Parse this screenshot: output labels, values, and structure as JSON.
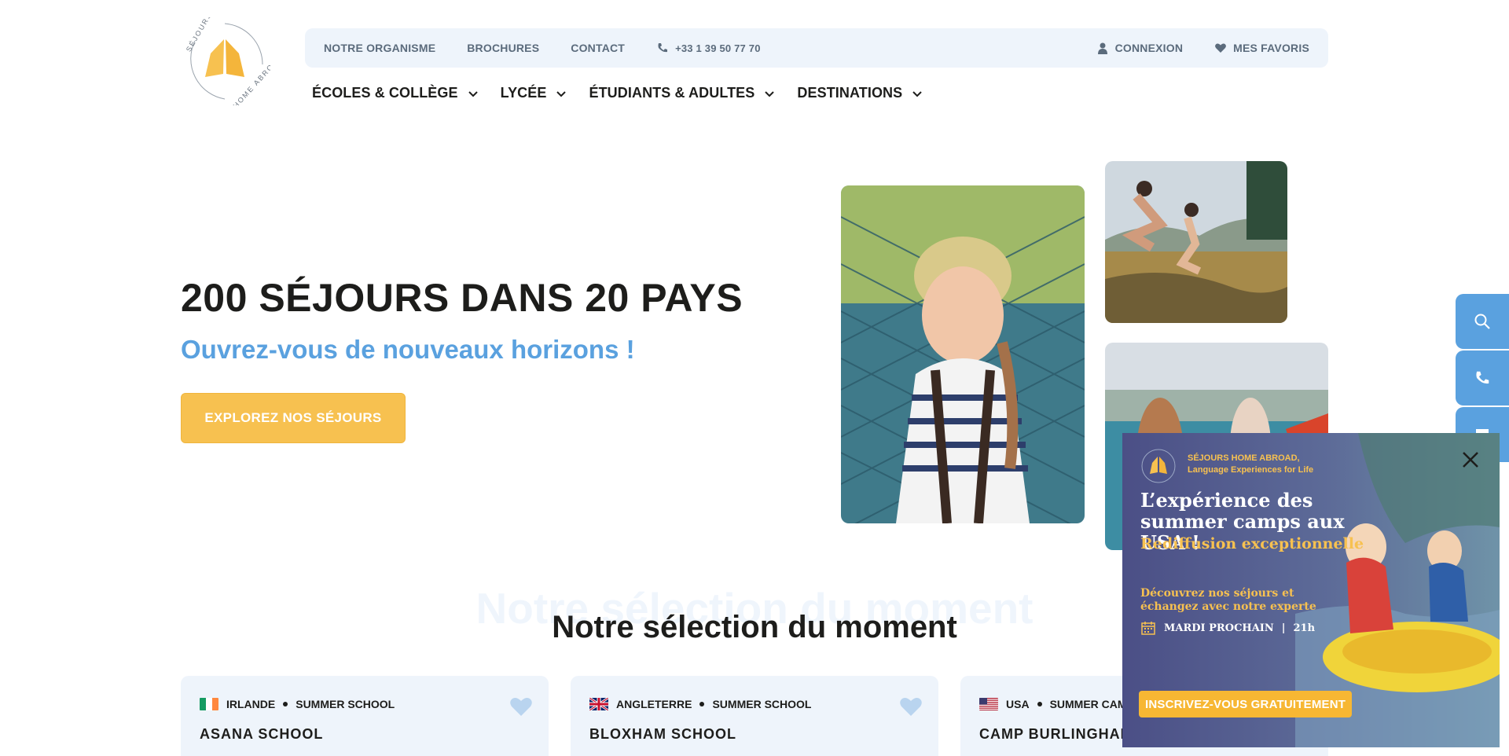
{
  "brand": {
    "logo_text_top": "SÉJOURS",
    "logo_text_bottom": "HOME ABROAD",
    "accent": "#f7c150",
    "blue": "#5aa1df",
    "dark": "#1d1d1b"
  },
  "topbar": {
    "about": "NOTRE ORGANISME",
    "brochures": "BROCHURES",
    "contact": "CONTACT",
    "phone": "+33 1 39 50 77 70",
    "login": "CONNEXION",
    "favorites": "MES FAVORIS"
  },
  "nav": {
    "items": [
      {
        "label": "ÉCOLES & COLLÈGE"
      },
      {
        "label": "LYCÉE"
      },
      {
        "label": "ÉTUDIANTS & ADULTES"
      },
      {
        "label": "DESTINATIONS"
      }
    ]
  },
  "hero": {
    "title": "200 SÉJOURS DANS 20 PAYS",
    "subtitle": "Ouvrez-vous de nouveaux horizons !",
    "cta": "EXPLOREZ NOS SÉJOURS"
  },
  "selection": {
    "ghost_title": "Notre sélection du moment",
    "title": "Notre sélection du moment",
    "cards": [
      {
        "country": "IRLANDE",
        "type": "SUMMER SCHOOL",
        "name": "ASANA SCHOOL",
        "flag": "ireland-flag"
      },
      {
        "country": "ANGLETERRE",
        "type": "SUMMER SCHOOL",
        "name": "BLOXHAM SCHOOL",
        "flag": "uk-flag"
      },
      {
        "country": "USA",
        "type": "SUMMER CAMP",
        "name": "CAMP BURLINGHAM",
        "flag": "usa-flag"
      }
    ]
  },
  "side_buttons": [
    "search-icon",
    "phone-icon",
    "chat-icon"
  ],
  "popup": {
    "brand_line1": "SÉJOURS HOME ABROAD,",
    "brand_line2": "Language Experiences for Life",
    "headline": "L’expérience des summer camps aux USA !",
    "subheadline": "Rediffusion exceptionnelle",
    "body": "Découvrez nos séjours et échangez avec notre experte",
    "date": "MARDI PROCHAIN",
    "time": "21h",
    "cta": "INSCRIVEZ-VOUS GRATUITEMENT"
  }
}
